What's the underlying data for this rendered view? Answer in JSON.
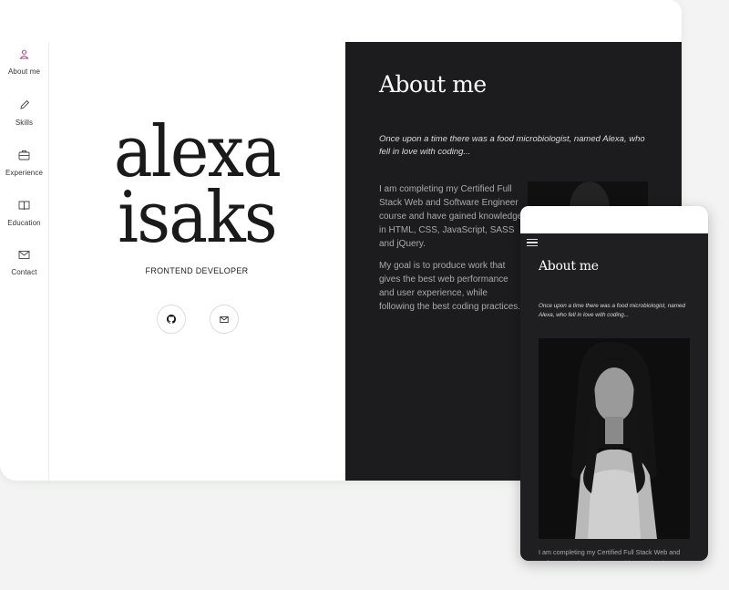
{
  "sidebar": {
    "items": [
      {
        "label": "About me",
        "icon": "user-icon",
        "active": true
      },
      {
        "label": "Skills",
        "icon": "pen-icon"
      },
      {
        "label": "Experience",
        "icon": "briefcase-icon"
      },
      {
        "label": "Education",
        "icon": "book-icon"
      },
      {
        "label": "Contact",
        "icon": "mail-icon"
      }
    ],
    "accent": "#8a3d7e"
  },
  "hero": {
    "first_name": "alexa",
    "last_name": "isaks",
    "role": "FRONTEND DEVELOPER",
    "github_icon": "github-icon",
    "mail_icon": "mail-icon"
  },
  "about": {
    "title": "About me",
    "quote": "Once upon a time there was a food microbiologist, named Alexa, who fell in love with coding...",
    "para1": "I am completing my Certified Full Stack Web and Software Engineer course and have gained knowledge in HTML, CSS, JavaScript, SASS and jQuery.",
    "para2": "My goal is to produce work that gives the best web performance and user experience, while following the best coding practices."
  },
  "mobile": {
    "title": "About me",
    "quote": "Once upon a time there was a food microbiologist, named Alexa, who fell in love with coding...",
    "para": "I am completing my Certified Full Stack Web and Software Engineer course and have gained"
  },
  "colors": {
    "dark_panel": "#1c1c1e",
    "background": "#f2f3f2"
  }
}
